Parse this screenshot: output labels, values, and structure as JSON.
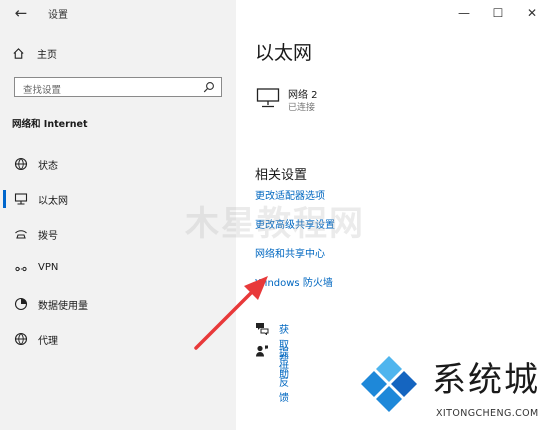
{
  "window": {
    "title": "设置",
    "controls": {
      "minimize": "—",
      "maximize": "☐",
      "close": "✕"
    }
  },
  "sidebar": {
    "home_label": "主页",
    "search_placeholder": "查找设置",
    "section_title": "网络和 Internet",
    "items": [
      {
        "label": "状态",
        "icon": "globe-status-icon"
      },
      {
        "label": "以太网",
        "icon": "ethernet-icon",
        "selected": true
      },
      {
        "label": "拨号",
        "icon": "dialup-icon"
      },
      {
        "label": "VPN",
        "icon": "vpn-icon"
      },
      {
        "label": "数据使用量",
        "icon": "data-usage-icon"
      },
      {
        "label": "代理",
        "icon": "globe-proxy-icon"
      }
    ]
  },
  "main": {
    "title": "以太网",
    "network": {
      "name": "网络 2",
      "status": "已连接"
    },
    "related_title": "相关设置",
    "links": [
      "更改适配器选项",
      "更改高级共享设置",
      "网络和共享中心",
      "Windows 防火墙"
    ],
    "help": [
      {
        "label": "获取帮助",
        "icon": "help-chat-icon"
      },
      {
        "label": "提供反馈",
        "icon": "feedback-icon"
      }
    ]
  },
  "overlay": {
    "watermark": "木星教程网",
    "arrow_color": "#e8393a",
    "logo_name": "系统城",
    "logo_url": "XITONGCHENG.COM",
    "logo_colors": [
      "#1e88d9",
      "#4fb5ee",
      "#1565c0"
    ]
  }
}
